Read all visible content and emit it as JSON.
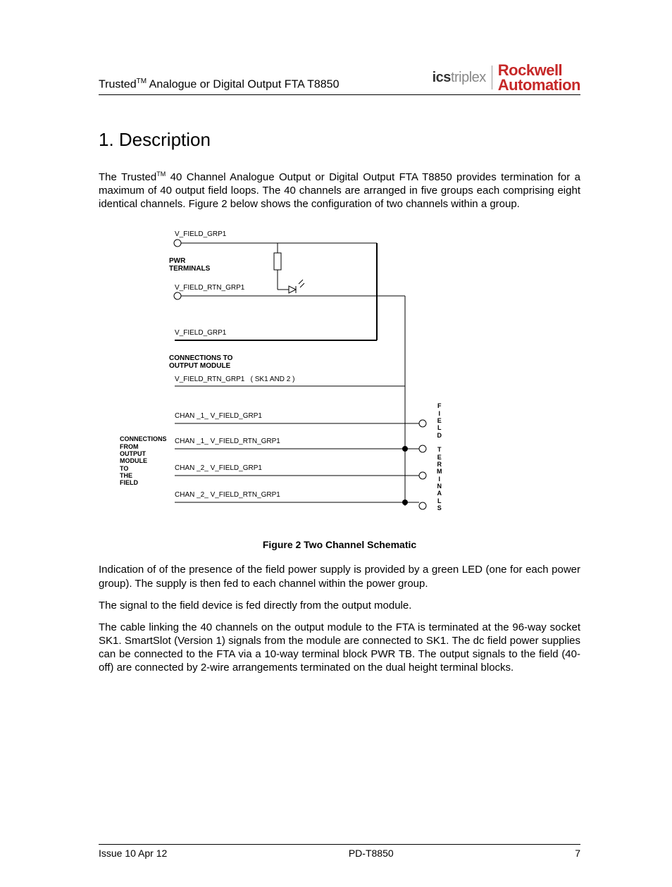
{
  "header": {
    "title_prefix": "Trusted",
    "title_tm": "TM",
    "title_rest": " Analogue or Digital Output FTA T8850",
    "ics_bold": "ics",
    "ics_light": "triplex",
    "ra_line1": "Rockwell",
    "ra_line2": "Automation"
  },
  "section_heading": "1.   Description",
  "para1_a": "The Trusted",
  "para1_tm": "TM",
  "para1_b": " 40 Channel Analogue Output or Digital Output FTA T8850 provides termination for a maximum of 40 output field loops.  The 40 channels are arranged in five groups each comprising eight identical channels.  Figure 2 below shows the configuration of two channels within a group.",
  "schem": {
    "v_field_grp1_top": "V_FIELD_GRP1",
    "pwr_terminals": "PWR\nTERMINALS",
    "v_field_rtn_grp1": "V_FIELD_RTN_GRP1",
    "v_field_grp1_mid": "V_FIELD_GRP1",
    "conn_to_output": "CONNECTIONS TO\nOUTPUT MODULE",
    "v_field_rtn_sk": "V_FIELD_RTN_GRP1   ( SK1 AND 2 )",
    "chan1_v": "CHAN _1_ V_FIELD_GRP1",
    "chan1_rtn": "CHAN _1_ V_FIELD_RTN_GRP1",
    "chan2_v": "CHAN _2_ V_FIELD_GRP1",
    "chan2_rtn": "CHAN _2_ V_FIELD_RTN_GRP1",
    "side_left": "CONNECTIONS\nFROM\nOUTPUT\nMODULE\nTO\nTHE\nFIELD",
    "side_right": "F\nI\nE\nL\nD\n\nT\nE\nR\nM\nI\nN\nA\nL\nS"
  },
  "figure_caption": "Figure 2 Two Channel Schematic",
  "para2": "Indication of of the presence of the field power supply is provided by a green LED (one for each power group).  The supply is then fed to each channel within the power group.",
  "para3": "The signal to the field device is fed directly from the output module.",
  "para4": "The cable linking the 40 channels on the output module to the FTA is terminated at the 96-way socket SK1.  SmartSlot (Version 1) signals from the module are connected to SK1. The dc field power supplies can be connected to the FTA via a 10-way terminal block PWR TB.  The output signals to the field (40-off) are connected by 2-wire arrangements terminated on the dual height terminal blocks.",
  "footer": {
    "left": "Issue 10 Apr 12",
    "center": "PD-T8850",
    "right": "7"
  }
}
